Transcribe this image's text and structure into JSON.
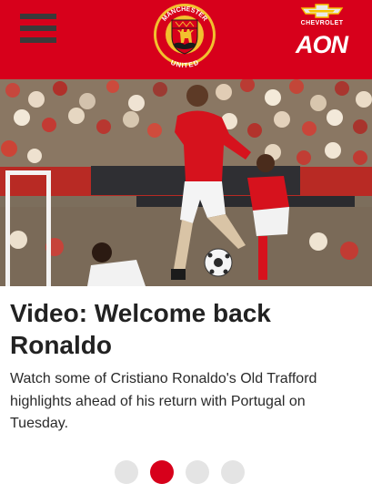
{
  "header": {
    "menu_icon": "hamburger-menu-icon",
    "crest": {
      "top_text": "MANCHESTER",
      "bottom_text": "UNITED"
    },
    "sponsors": {
      "chevrolet": "CHEVROLET",
      "aon": "AON"
    }
  },
  "colors": {
    "brand_red": "#d7001b",
    "menu_icon": "#3a3a3a",
    "crest_gold": "#f2c12e",
    "text": "#222222"
  },
  "article": {
    "headline": "Video: Welcome back Ronaldo",
    "summary": "Watch some of Cristiano Ronaldo's Old Trafford highlights ahead of his return with Portugal on Tuesday."
  },
  "carousel": {
    "count": 4,
    "active": 2
  }
}
